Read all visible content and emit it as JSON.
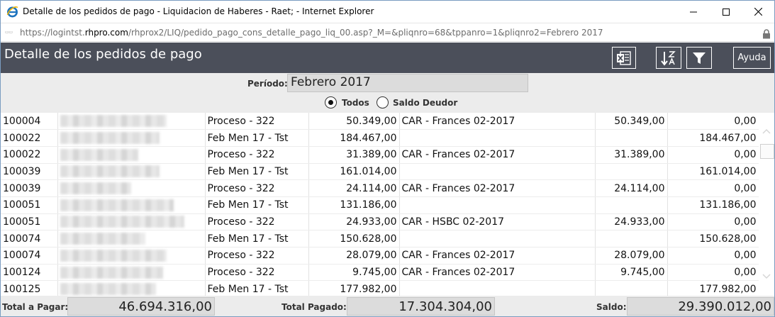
{
  "window": {
    "title": "Detalle de los pedidos de pago - Liquidacion de Haberes - Raet; - Internet Explorer",
    "url_prefix": "https://logintst.",
    "url_domain": "rhpro.com",
    "url_path": "/rhprox2/LIQ/pedido_pago_cons_detalle_pago_liq_00.asp?_M=&pliqnro=68&tppanro=1&pliqnro2=Febrero 2017"
  },
  "header": {
    "title": "Detalle de los pedidos de pago",
    "help_label": "Ayuda"
  },
  "filters": {
    "period_label": "Período:",
    "period_value": "Febrero 2017",
    "radio_all_label": "Todos",
    "radio_debtor_label": "Saldo Deudor",
    "selected": "Todos"
  },
  "rows": [
    {
      "legajo": "100004",
      "proceso": "Proceso - 322",
      "importe": "50.349,00",
      "cuenta": "CAR - Frances 02-2017",
      "pagado": "50.349,00",
      "saldo": "0,00"
    },
    {
      "legajo": "100022",
      "proceso": "Feb Men 17 - Tst",
      "importe": "184.467,00",
      "cuenta": "",
      "pagado": "",
      "saldo": "184.467,00"
    },
    {
      "legajo": "100022",
      "proceso": "Proceso - 322",
      "importe": "31.389,00",
      "cuenta": "CAR - Frances 02-2017",
      "pagado": "31.389,00",
      "saldo": "0,00"
    },
    {
      "legajo": "100039",
      "proceso": "Feb Men 17 - Tst",
      "importe": "161.014,00",
      "cuenta": "",
      "pagado": "",
      "saldo": "161.014,00"
    },
    {
      "legajo": "100039",
      "proceso": "Proceso - 322",
      "importe": "24.114,00",
      "cuenta": "CAR - Frances 02-2017",
      "pagado": "24.114,00",
      "saldo": "0,00"
    },
    {
      "legajo": "100051",
      "proceso": "Feb Men 17 - Tst",
      "importe": "131.186,00",
      "cuenta": "",
      "pagado": "",
      "saldo": "131.186,00"
    },
    {
      "legajo": "100051",
      "proceso": "Proceso - 322",
      "importe": "24.933,00",
      "cuenta": "CAR - HSBC 02-2017",
      "pagado": "24.933,00",
      "saldo": "0,00"
    },
    {
      "legajo": "100074",
      "proceso": "Feb Men 17 - Tst",
      "importe": "150.628,00",
      "cuenta": "",
      "pagado": "",
      "saldo": "150.628,00"
    },
    {
      "legajo": "100074",
      "proceso": "Proceso - 322",
      "importe": "28.079,00",
      "cuenta": "CAR - Frances 02-2017",
      "pagado": "28.079,00",
      "saldo": "0,00"
    },
    {
      "legajo": "100124",
      "proceso": "Proceso - 322",
      "importe": "9.745,00",
      "cuenta": "CAR - Frances 02-2017",
      "pagado": "9.745,00",
      "saldo": "0,00"
    },
    {
      "legajo": "100125",
      "proceso": "Feb Men 17 - Tst",
      "importe": "177.982,00",
      "cuenta": "",
      "pagado": "",
      "saldo": "177.982,00"
    }
  ],
  "totals": {
    "total_pagar_label": "Total a Pagar:",
    "total_pagar_value": "46.694.316,00",
    "total_pagado_label": "Total Pagado:",
    "total_pagado_value": "17.304.304,00",
    "saldo_label": "Saldo:",
    "saldo_value": "29.390.012,00"
  },
  "colors": {
    "header_bg": "#4b4f5a",
    "filter_bg": "#ececec",
    "ie_blue": "#1e73be"
  },
  "icons": [
    "ie-icon",
    "minimize-icon",
    "maximize-icon",
    "close-icon",
    "lock-icon",
    "excel-icon",
    "sort-az-icon",
    "filter-icon",
    "scroll-up-icon",
    "scroll-down-icon"
  ]
}
